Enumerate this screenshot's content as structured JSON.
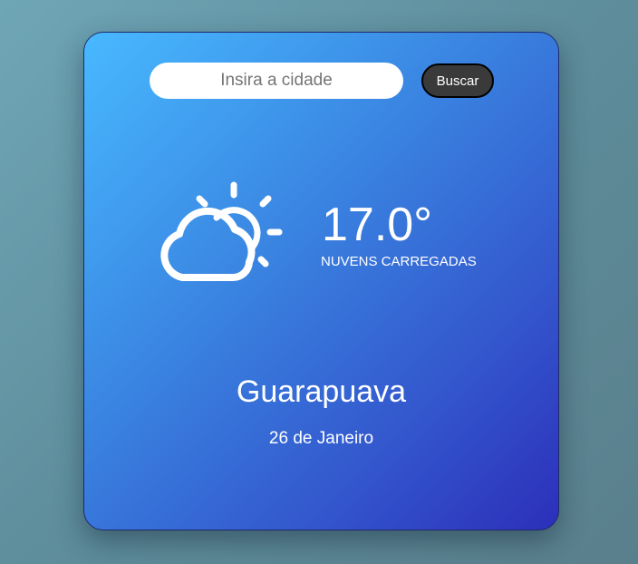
{
  "search": {
    "placeholder": "Insira a cidade",
    "value": "",
    "button_label": "Buscar"
  },
  "weather": {
    "icon": "partly-cloudy-icon",
    "temperature": "17.0°",
    "description": "NUVENS CARREGADAS",
    "city": "Guarapuava",
    "date": "26 de Janeiro"
  },
  "colors": {
    "page_background": "#6a9aaa",
    "card_gradient_start": "#48b9ff",
    "card_gradient_end": "#2c2fba",
    "button_background": "#3a3a3a",
    "text": "#ffffff"
  }
}
